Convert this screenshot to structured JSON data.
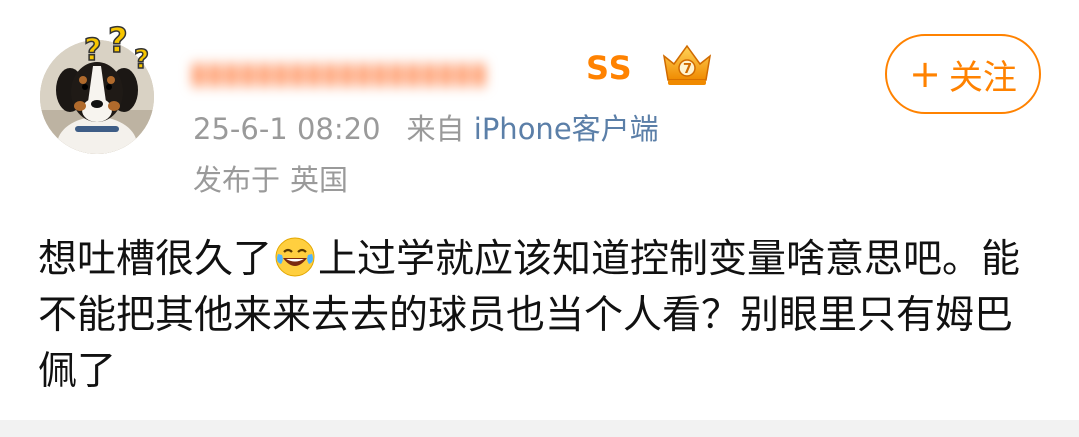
{
  "user": {
    "name_visible_tail": "SS",
    "avatar_icon": "bernese-dog-avatar",
    "avatar_decoration_icon": "question-marks-icon",
    "badge_icon": "vip-crown-icon"
  },
  "follow_button": {
    "plus": "+",
    "label": "关注"
  },
  "meta": {
    "time": "25-6-1 08:20",
    "from_label": "来自",
    "client": "iPhone客户端",
    "location_label": "发布于",
    "location": "英国"
  },
  "post": {
    "text_before_emoji": "想吐槽很久了",
    "emoji_icon": "laugh-cry-emoji",
    "text_after_emoji": "上过学就应该知道控制变量啥意思吧。能不能把其他来来去去的球员也当个人看？别眼里只有姆巴佩了"
  },
  "colors": {
    "accent": "#ff8200",
    "meta_gray": "#9a9a9a",
    "link_blue": "#5b7fa8",
    "text": "#111111"
  }
}
